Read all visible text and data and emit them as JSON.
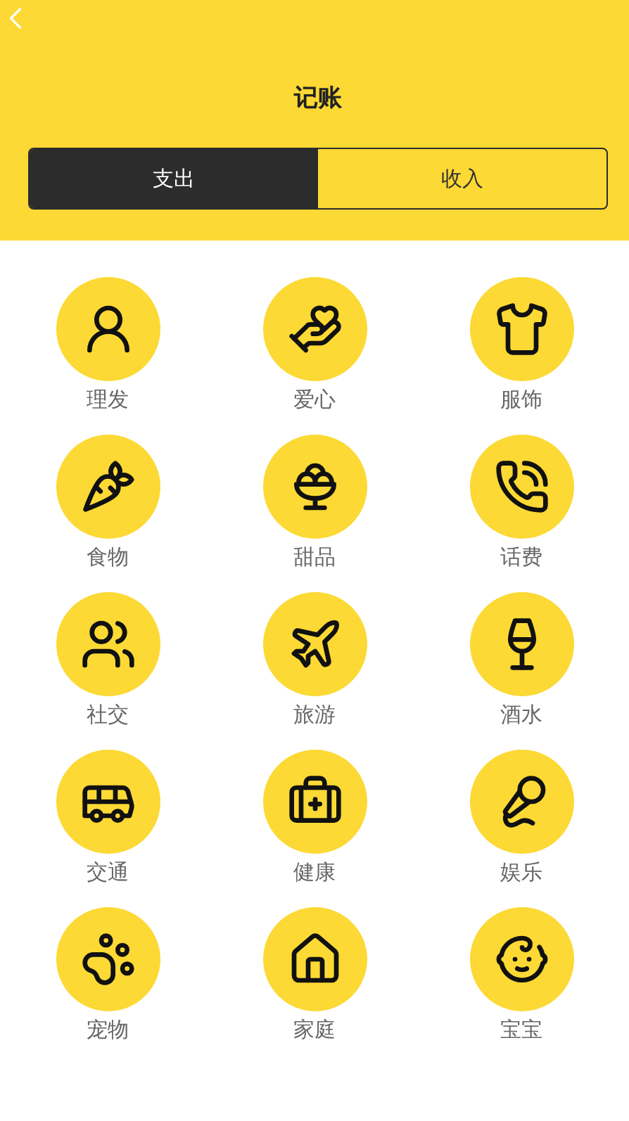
{
  "header": {
    "title": "记账"
  },
  "tabs": [
    {
      "label": "支出",
      "selected": true
    },
    {
      "label": "收入",
      "selected": false
    }
  ],
  "categories": [
    {
      "label": "理发"
    },
    {
      "label": "爱心"
    },
    {
      "label": "服饰"
    },
    {
      "label": "食物"
    },
    {
      "label": "甜品"
    },
    {
      "label": "话费"
    },
    {
      "label": "社交"
    },
    {
      "label": "旅游"
    },
    {
      "label": "酒水"
    },
    {
      "label": "交通"
    },
    {
      "label": "健康"
    },
    {
      "label": "娱乐"
    },
    {
      "label": "宠物"
    },
    {
      "label": "家庭"
    },
    {
      "label": "宝宝"
    }
  ]
}
